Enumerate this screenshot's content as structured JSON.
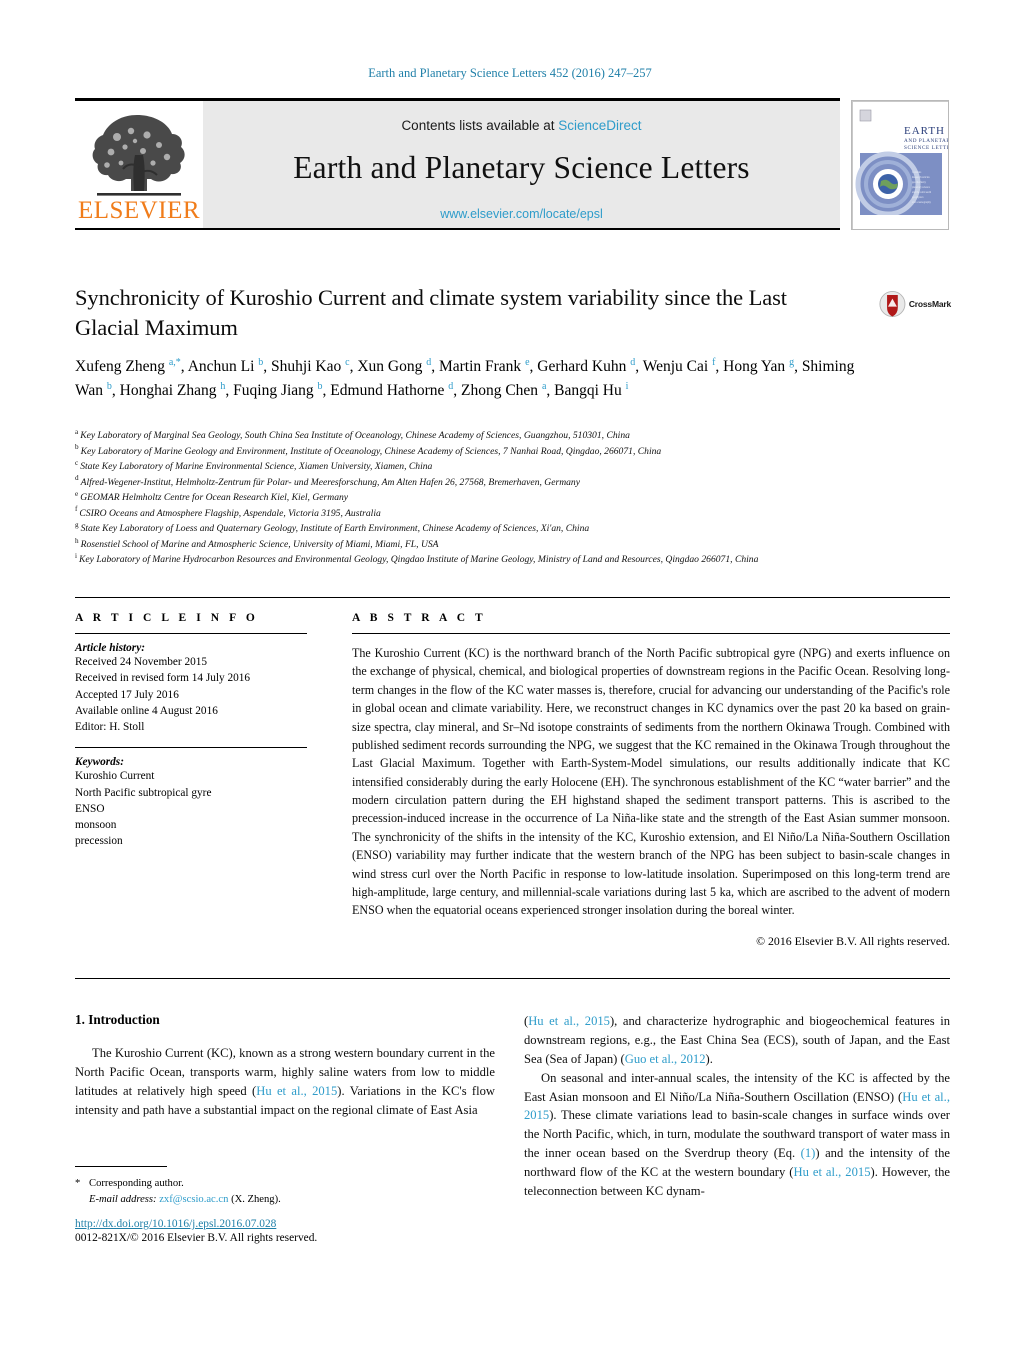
{
  "running_head": "Earth and Planetary Science Letters 452 (2016) 247–257",
  "masthead": {
    "publisher_name": "ELSEVIER",
    "contents_prefix": "Contents lists available at ",
    "sciencedirect": "ScienceDirect",
    "journal_name": "Earth and Planetary Science Letters",
    "journal_url": "www.elsevier.com/locate/epsl",
    "cover_title_line1": "EARTH",
    "cover_title_line2": "AND PLANETARY",
    "cover_title_line3": "SCIENCE LETTERS"
  },
  "crossmark": {
    "label": "CrossMark"
  },
  "title": "Synchronicity of Kuroshio Current and climate system variability since the Last Glacial Maximum",
  "authors_html": "Xufeng Zheng <sup>a,*</sup>, Anchun Li <sup>b</sup>, Shuhji Kao <sup>c</sup>, Xun Gong <sup>d</sup>, Martin Frank <sup>e</sup>, Gerhard Kuhn <sup>d</sup>, Wenju Cai <sup>f</sup>, Hong Yan <sup>g</sup>, Shiming Wan <sup>b</sup>, Honghai Zhang <sup>h</sup>, Fuqing Jiang <sup>b</sup>, Edmund Hathorne <sup>d</sup>, Zhong Chen <sup>a</sup>, Bangqi Hu <sup>i</sup>",
  "affiliations": [
    {
      "mark": "a",
      "text": "Key Laboratory of Marginal Sea Geology, South China Sea Institute of Oceanology, Chinese Academy of Sciences, Guangzhou, 510301, China"
    },
    {
      "mark": "b",
      "text": "Key Laboratory of Marine Geology and Environment, Institute of Oceanology, Chinese Academy of Sciences, 7 Nanhai Road, Qingdao, 266071, China"
    },
    {
      "mark": "c",
      "text": "State Key Laboratory of Marine Environmental Science, Xiamen University, Xiamen, China"
    },
    {
      "mark": "d",
      "text": "Alfred-Wegener-Institut, Helmholtz-Zentrum für Polar- und Meeresforschung, Am Alten Hafen 26, 27568, Bremerhaven, Germany"
    },
    {
      "mark": "e",
      "text": "GEOMAR Helmholtz Centre for Ocean Research Kiel, Kiel, Germany"
    },
    {
      "mark": "f",
      "text": "CSIRO Oceans and Atmosphere Flagship, Aspendale, Victoria 3195, Australia"
    },
    {
      "mark": "g",
      "text": "State Key Laboratory of Loess and Quaternary Geology, Institute of Earth Environment, Chinese Academy of Sciences, Xi'an, China"
    },
    {
      "mark": "h",
      "text": "Rosenstiel School of Marine and Atmospheric Science, University of Miami, Miami, FL, USA"
    },
    {
      "mark": "i",
      "text": "Key Laboratory of Marine Hydrocarbon Resources and Environmental Geology, Qingdao Institute of Marine Geology, Ministry of Land and Resources, Qingdao 266071, China"
    }
  ],
  "article_info": {
    "heading": "A R T I C L E    I N F O",
    "history_label": "Article history:",
    "history_lines": [
      "Received 24 November 2015",
      "Received in revised form 14 July 2016",
      "Accepted 17 July 2016",
      "Available online 4 August 2016",
      "Editor: H. Stoll"
    ],
    "keywords_label": "Keywords:",
    "keywords": [
      "Kuroshio Current",
      "North Pacific subtropical gyre",
      "ENSO",
      "monsoon",
      "precession"
    ]
  },
  "abstract": {
    "heading": "A B S T R A C T",
    "text": "The Kuroshio Current (KC) is the northward branch of the North Pacific subtropical gyre (NPG) and exerts influence on the exchange of physical, chemical, and biological properties of downstream regions in the Pacific Ocean. Resolving long-term changes in the flow of the KC water masses is, therefore, crucial for advancing our understanding of the Pacific's role in global ocean and climate variability. Here, we reconstruct changes in KC dynamics over the past 20 ka based on grain-size spectra, clay mineral, and Sr–Nd isotope constraints of sediments from the northern Okinawa Trough. Combined with published sediment records surrounding the NPG, we suggest that the KC remained in the Okinawa Trough throughout the Last Glacial Maximum. Together with Earth-System-Model simulations, our results additionally indicate that KC intensified considerably during the early Holocene (EH). The synchronous establishment of the KC “water barrier” and the modern circulation pattern during the EH highstand shaped the sediment transport patterns. This is ascribed to the precession-induced increase in the occurrence of La Niña-like state and the strength of the East Asian summer monsoon. The synchronicity of the shifts in the intensity of the KC, Kuroshio extension, and El Niño/La Niña-Southern Oscillation (ENSO) variability may further indicate that the western branch of the NPG has been subject to basin-scale changes in wind stress curl over the North Pacific in response to low-latitude insolation. Superimposed on this long-term trend are high-amplitude, large century, and millennial-scale variations during last 5 ka, which are ascribed to the advent of modern ENSO when the equatorial oceans experienced stronger insolation during the boreal winter.",
    "copyright": "© 2016 Elsevier B.V. All rights reserved."
  },
  "introduction": {
    "heading": "1. Introduction",
    "left_paragraph_html": "The Kuroshio Current (KC), known as a strong western boundary current in the North Pacific Ocean, transports warm, highly saline waters from low to middle latitudes at relatively high speed (<span class=\"ref\">Hu et al., 2015</span>). Variations in the KC's flow intensity and path have a substantial impact on the regional climate of East Asia",
    "right_paragraph_1_html": "(<span class=\"ref\">Hu et al., 2015</span>), and characterize hydrographic and biogeochemical features in downstream regions, e.g., the East China Sea (ECS), south of Japan, and the East Sea (Sea of Japan) (<span class=\"ref\">Guo et al., 2012</span>).",
    "right_paragraph_2_html": "On seasonal and inter-annual scales, the intensity of the KC is affected by the East Asian monsoon and El Niño/La Niña-Southern Oscillation (ENSO) (<span class=\"ref\">Hu et al., 2015</span>). These climate variations lead to basin-scale changes in surface winds over the North Pacific, which, in turn, modulate the southward transport of water mass in the inner ocean based on the Sverdrup theory (Eq. <span class=\"ref\">(1)</span>) and the intensity of the northward flow of the KC at the western boundary (<span class=\"ref\">Hu et al., 2015</span>). However, the teleconnection between KC dynam-"
  },
  "footnote": {
    "corresponding_author": "Corresponding author.",
    "email_label": "E-mail address:",
    "email": "zxf@scsio.ac.cn",
    "email_suffix": "(X. Zheng)."
  },
  "footer": {
    "doi": "http://dx.doi.org/10.1016/j.epsl.2016.07.028",
    "issn_line": "0012-821X/© 2016 Elsevier B.V. All rights reserved."
  },
  "colors": {
    "link_blue": "#2e9cca",
    "header_blue": "#1f7fa8",
    "elsevier_orange": "#F07C1A",
    "masthead_grey": "#e9e9e9"
  }
}
